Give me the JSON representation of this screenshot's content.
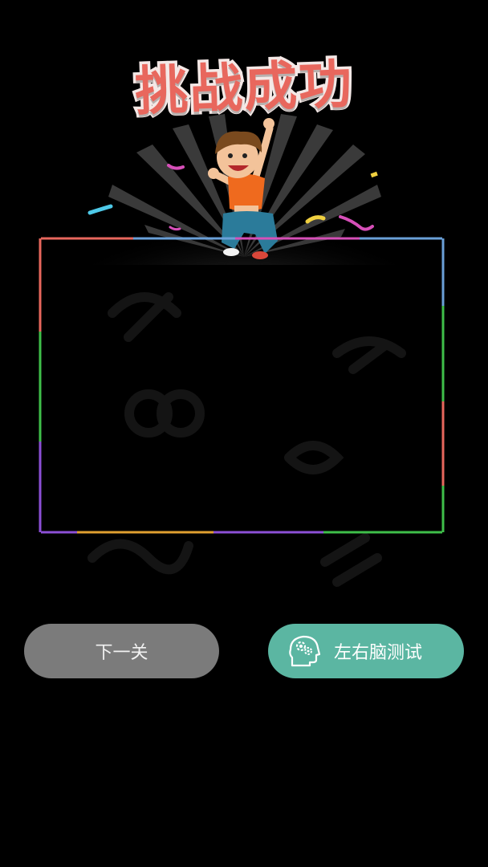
{
  "header": {
    "title": "挑战成功"
  },
  "actions": {
    "next_label": "下一关",
    "brain_test_label": "左右脑测试"
  },
  "icons": {
    "brain_button_icon": "brain-gears-icon",
    "hero_image": "jumping-kid-illustration"
  },
  "colors": {
    "background": "#000000",
    "title": "#e8675d",
    "title_outline": "#f4e8e6",
    "next_button": "#7b7b7b",
    "brain_button": "#5bb6a2",
    "frame_red": "#e8675d",
    "frame_pink": "#d64fb8",
    "frame_blue": "#6aa0d8",
    "frame_green": "#3fbf4a",
    "frame_purple": "#8c4fd6",
    "frame_orange": "#e0a030"
  }
}
